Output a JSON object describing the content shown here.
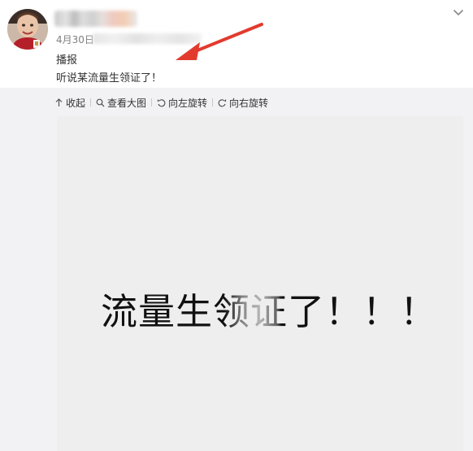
{
  "post": {
    "date": "4月30日",
    "source_label": "播报",
    "text": "听说某流量生领证了！"
  },
  "toolbar": {
    "collapse_label": "收起",
    "view_large_label": "查看大图",
    "rotate_left_label": "向左旋转",
    "rotate_right_label": "向右旋转"
  },
  "image": {
    "caption": "流量生领证了！！！"
  },
  "icons": {
    "collapse": "arrow-up-icon",
    "view_large": "magnifier-icon",
    "rotate_left": "rotate-left-icon",
    "rotate_right": "rotate-right-icon",
    "menu": "chevron-down-icon"
  },
  "colors": {
    "annotation_arrow": "#e23b2e",
    "panel_bg": "#f2f2f5",
    "text": "#333333",
    "muted": "#808080"
  }
}
